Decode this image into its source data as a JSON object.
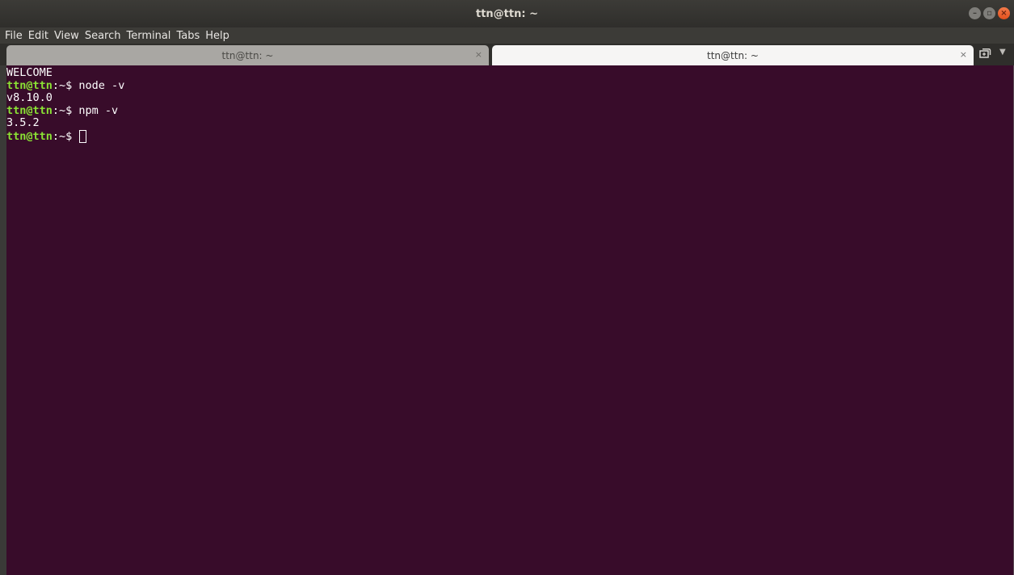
{
  "window": {
    "title": "ttn@ttn: ~"
  },
  "menu": [
    "File",
    "Edit",
    "View",
    "Search",
    "Terminal",
    "Tabs",
    "Help"
  ],
  "tabs": [
    {
      "label": "ttn@ttn: ~",
      "close": "×",
      "active": false
    },
    {
      "label": "ttn@ttn: ~",
      "close": "×",
      "active": true
    }
  ],
  "terminal": {
    "background": "#380c2a",
    "prompt_color": "#8ae234",
    "welcome": "WELCOME",
    "lines": [
      {
        "user": "ttn@ttn",
        "sep": ":~$ ",
        "cmd": "node -v",
        "output": "v8.10.0"
      },
      {
        "user": "ttn@ttn",
        "sep": ":~$ ",
        "cmd": "npm -v",
        "output": "3.5.2"
      }
    ],
    "current_prompt": {
      "user": "ttn@ttn",
      "sep": ":~$ "
    }
  },
  "icons": {
    "new_tab": "new-tab-icon",
    "dropdown": "tabs-dropdown-icon"
  }
}
